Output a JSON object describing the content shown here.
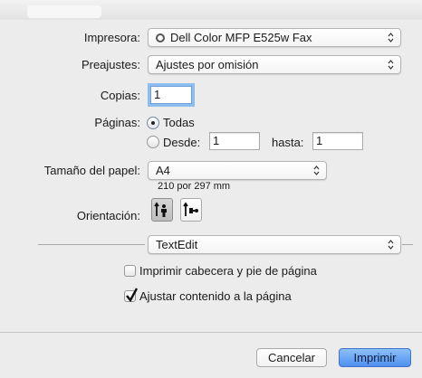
{
  "window": {
    "title": ""
  },
  "printer": {
    "label": "Impresora:",
    "value": "Dell Color MFP E525w Fax"
  },
  "presets": {
    "label": "Preajustes:",
    "value": "Ajustes por omisión"
  },
  "copies": {
    "label": "Copias:",
    "value": "1"
  },
  "pages": {
    "label": "Páginas:",
    "all_label": "Todas",
    "from_label": "Desde:",
    "from_value": "1",
    "to_label": "hasta:",
    "to_value": "1",
    "selected": "Todas"
  },
  "paper": {
    "label": "Tamaño del papel:",
    "value": "A4",
    "size_text": "210 por 297 mm"
  },
  "orientation": {
    "label": "Orientación:",
    "selected": "portrait"
  },
  "app_section": {
    "value": "TextEdit"
  },
  "options": {
    "header_footer_label": "Imprimir cabecera y pie de página",
    "header_footer_checked": false,
    "fit_content_label": "Ajustar contenido a la página",
    "fit_content_checked": true
  },
  "buttons": {
    "cancel": "Cancelar",
    "print": "Imprimir"
  },
  "colors": {
    "accent": "#4f90f0",
    "focus_ring": "#8ebef0",
    "background": "#ececec"
  },
  "icons": [
    "printer-status-icon",
    "popup-arrows-icon",
    "portrait-orientation-icon",
    "landscape-orientation-icon",
    "checkmark-icon"
  ]
}
